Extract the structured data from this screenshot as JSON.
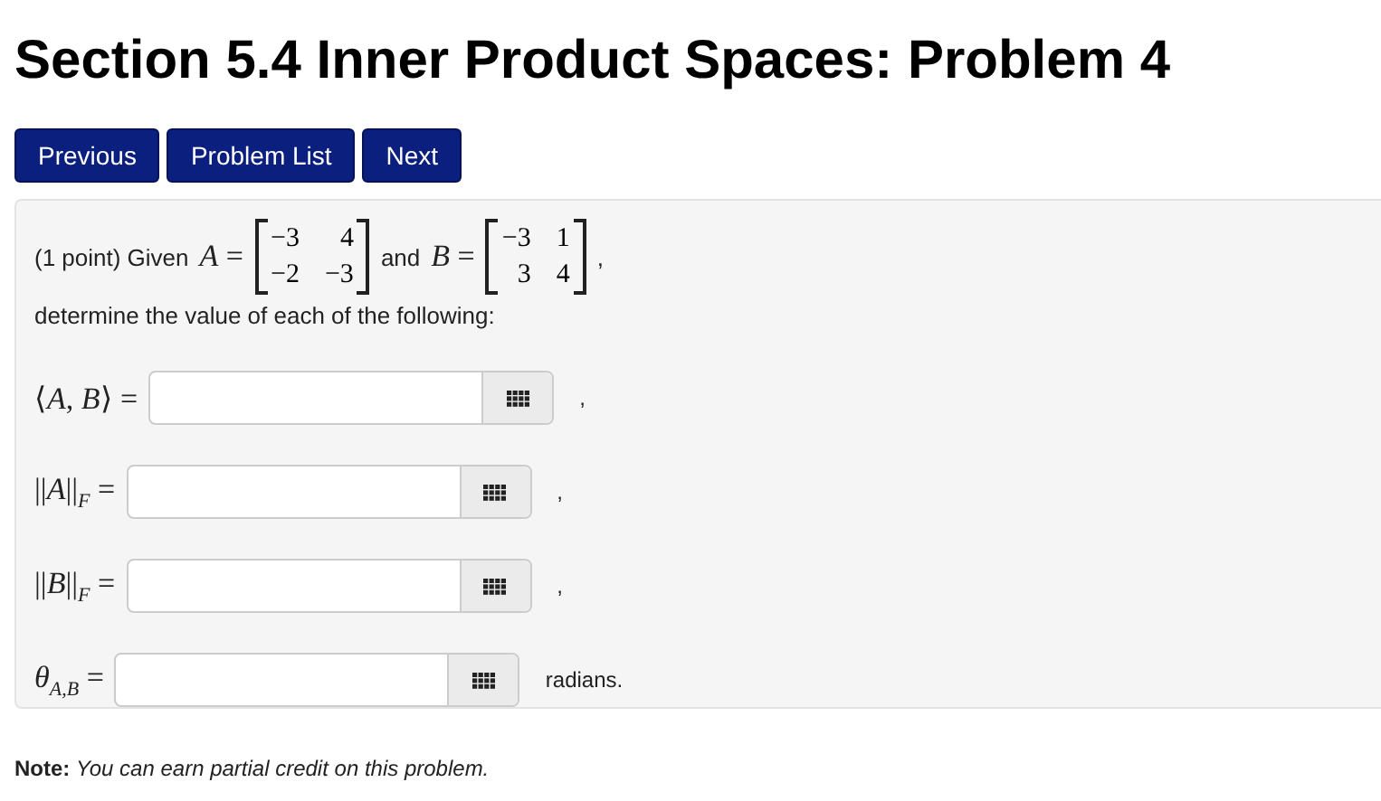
{
  "title": "Section 5.4 Inner Product Spaces: Problem 4",
  "nav_buttons": [
    "Previous",
    "Problem List",
    "Next"
  ],
  "problem": {
    "points": "(1 point) Given",
    "matrices": [
      {
        "name": "A =",
        "rows": [
          [
            "−3",
            "4"
          ],
          [
            "−2",
            "−3"
          ]
        ],
        "after": "and"
      },
      {
        "name": "B =",
        "rows": [
          [
            "−3",
            "1"
          ],
          [
            "3",
            "4"
          ]
        ],
        "after": ","
      }
    ],
    "instruction": "determine the value of each of the following:",
    "answers": [
      {
        "label": "⟨*A*, *B*⟩ =",
        "suffix": ","
      },
      {
        "label": "||*A*||$_{F}$ =",
        "suffix": ","
      },
      {
        "label": "||*B*||$_{F}$ =",
        "suffix": ","
      },
      {
        "label": "*θ*$_{A,B}$ =",
        "suffix": "radians."
      }
    ]
  },
  "note": {
    "label": "Note:",
    "text": "You can earn partial credit on this problem."
  }
}
